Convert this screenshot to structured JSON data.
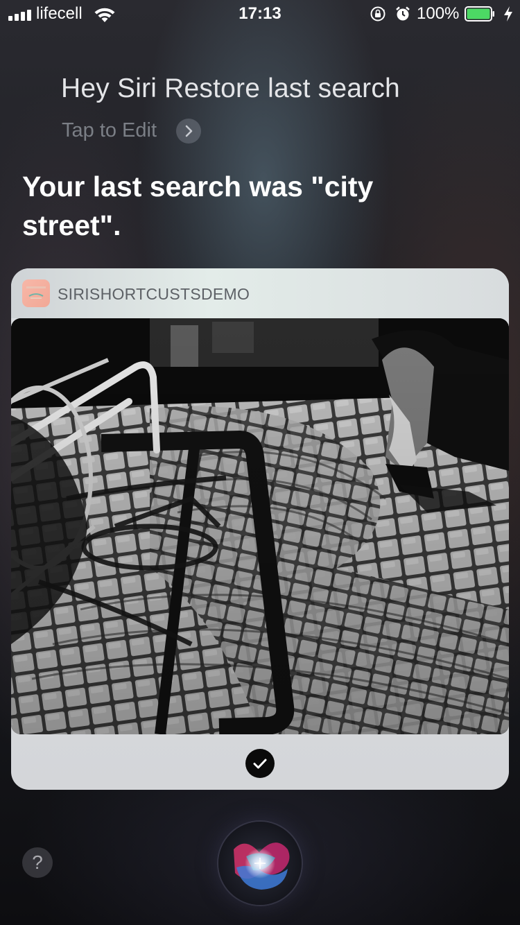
{
  "status_bar": {
    "carrier": "lifecell",
    "time": "17:13",
    "battery_percent": "100%",
    "battery_level": 1.0,
    "icons": [
      "signal-icon",
      "wifi-icon",
      "rotation-lock-icon",
      "alarm-icon",
      "battery-icon",
      "charging-bolt-icon"
    ]
  },
  "siri": {
    "query": "Hey Siri Restore last search",
    "tap_to_edit": "Tap to Edit",
    "response": "Your last search was \"city street\"."
  },
  "card": {
    "app_name": "SIRISHORTCUSTSDEMO",
    "image_description_icon": "photo-city-street",
    "confirm_icon": "checkmark-icon"
  },
  "bottom": {
    "help_label": "?",
    "siri_icon": "siri-orb-icon"
  },
  "colors": {
    "battery_fill": "#4cd964",
    "card_background": "#d6d8db",
    "confirm_background": "#0a0a0a"
  }
}
